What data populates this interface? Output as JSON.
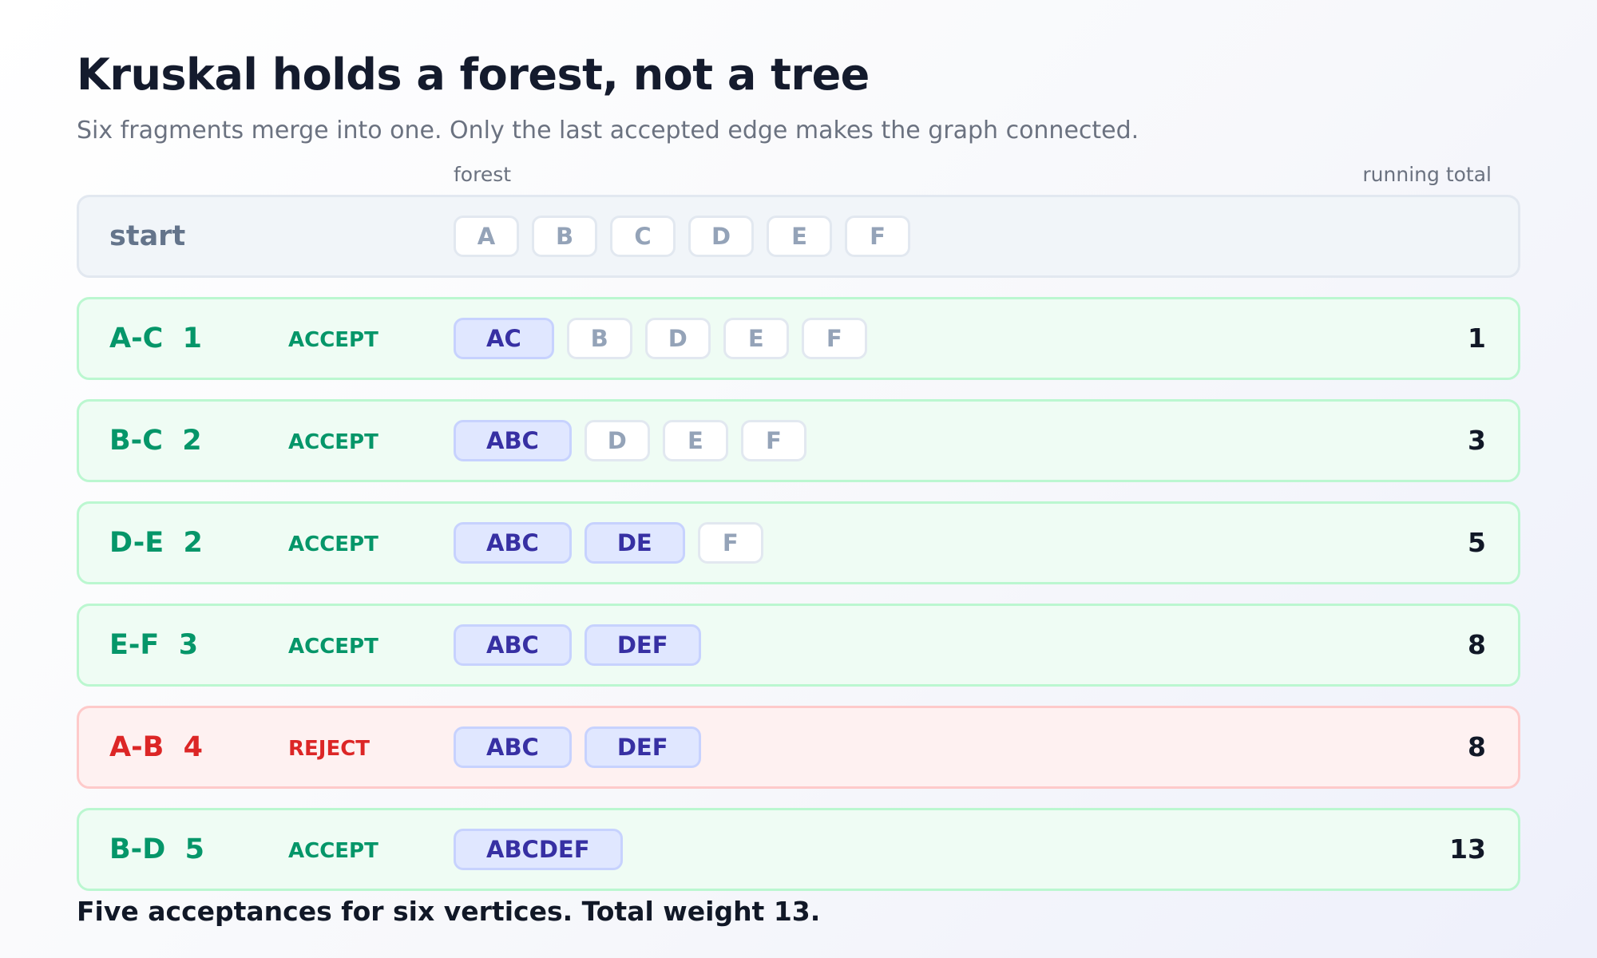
{
  "title": "Kruskal holds a forest, not a tree",
  "subtitle": "Six fragments merge into one. Only the last accepted edge makes the graph connected.",
  "columns": {
    "forest": "forest",
    "total": "running total"
  },
  "rows": [
    {
      "edge": "start",
      "verdict": "",
      "status": "start",
      "forest": [
        "A",
        "B",
        "C",
        "D",
        "E",
        "F"
      ],
      "total": ""
    },
    {
      "edge": "A-C  1",
      "verdict": "ACCEPT",
      "status": "accept",
      "forest": [
        "AC",
        "B",
        "D",
        "E",
        "F"
      ],
      "total": "1"
    },
    {
      "edge": "B-C  2",
      "verdict": "ACCEPT",
      "status": "accept",
      "forest": [
        "ABC",
        "D",
        "E",
        "F"
      ],
      "total": "3"
    },
    {
      "edge": "D-E  2",
      "verdict": "ACCEPT",
      "status": "accept",
      "forest": [
        "ABC",
        "DE",
        "F"
      ],
      "total": "5"
    },
    {
      "edge": "E-F  3",
      "verdict": "ACCEPT",
      "status": "accept",
      "forest": [
        "ABC",
        "DEF"
      ],
      "total": "8"
    },
    {
      "edge": "A-B  4",
      "verdict": "REJECT",
      "status": "reject",
      "forest": [
        "ABC",
        "DEF"
      ],
      "total": "8"
    },
    {
      "edge": "B-D  5",
      "verdict": "ACCEPT",
      "status": "accept",
      "forest": [
        "ABCDEF"
      ],
      "total": "13"
    }
  ],
  "footer": "Five acceptances for six vertices. Total weight 13.",
  "colors": {
    "accept": "#059669",
    "reject": "#dc2626",
    "merged_fragment": "#3730a3",
    "single_vertex": "#94a3b8"
  }
}
